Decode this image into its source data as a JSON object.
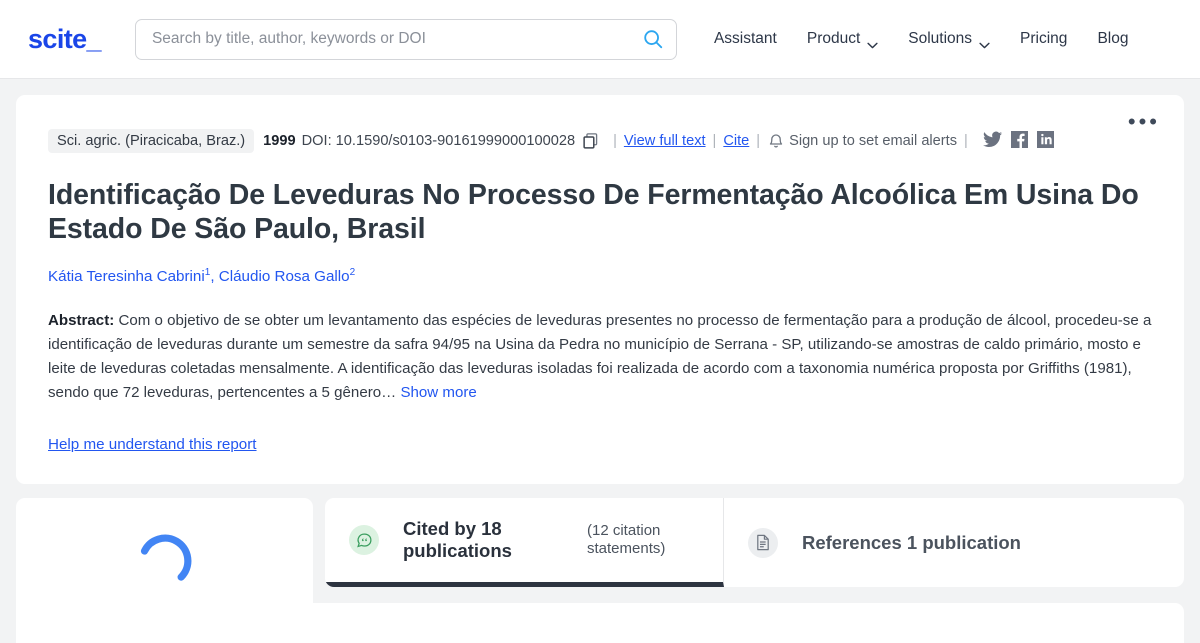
{
  "header": {
    "logo": "scite_",
    "search": {
      "placeholder": "Search by title, author, keywords or DOI",
      "value": "",
      "icon": "search-icon"
    },
    "nav": [
      {
        "label": "Assistant",
        "dropdown": false
      },
      {
        "label": "Product",
        "dropdown": true
      },
      {
        "label": "Solutions",
        "dropdown": true
      },
      {
        "label": "Pricing",
        "dropdown": false
      },
      {
        "label": "Blog",
        "dropdown": false
      }
    ]
  },
  "paper": {
    "journal": "Sci. agric. (Piracicaba, Braz.)",
    "year": "1999",
    "doi": "DOI: 10.1590/s0103-90161999000100028",
    "copy_icon": "copy-icon",
    "view_full_text": "View full text",
    "cite": "Cite",
    "bell_icon": "bell-icon",
    "email_alerts": "Sign up to set email alerts",
    "separator": "|",
    "socials": [
      {
        "name": "twitter-icon"
      },
      {
        "name": "facebook-icon"
      },
      {
        "name": "linkedin-icon"
      }
    ],
    "more_menu": "•••",
    "title": "Identificação De Leveduras No Processo De Fermentação Alcoólica Em Usina Do Estado De São Paulo, Brasil",
    "authors": [
      {
        "name": "Kátia Teresinha Cabrini",
        "affiliation": "1"
      },
      {
        "name": "Cláudio Rosa Gallo",
        "affiliation": "2"
      }
    ],
    "authors_separator": ", ",
    "abstract_label": "Abstract:",
    "abstract_text": " Com o objetivo de se obter um levantamento das espécies de leveduras presentes no processo de fermentação para a produção de álcool, procedeu-se a identificação de leveduras durante um semestre da safra 94/95 na Usina da Pedra no município de Serrana - SP, utilizando-se amostras de caldo primário, mosto e leite de leveduras coletadas mensalmente. A identificação das leveduras isoladas foi realizada de acordo com a taxonomia numérica proposta por Griffiths (1981), sendo que 72 leveduras, pertencentes a 5 gênero… ",
    "show_more": "Show more",
    "help_link": "Help me understand this report"
  },
  "bottom": {
    "spinner": "loading-spinner",
    "tabs": [
      {
        "icon": "citation-quote-icon",
        "label": "Cited by 18 publications",
        "sub": "(12 citation statements)",
        "active": true
      },
      {
        "icon": "document-icon",
        "label": "References 1 publication",
        "sub": "",
        "active": false
      }
    ]
  },
  "colors": {
    "brand_blue": "#1a45e8",
    "link_blue": "#2256f0",
    "search_icon_blue": "#2ba6f0",
    "page_bg": "#f2f3f4",
    "active_tab_border": "#2d3440",
    "green_accent": "#3a9e5f",
    "social_grey": "#6b7280"
  }
}
